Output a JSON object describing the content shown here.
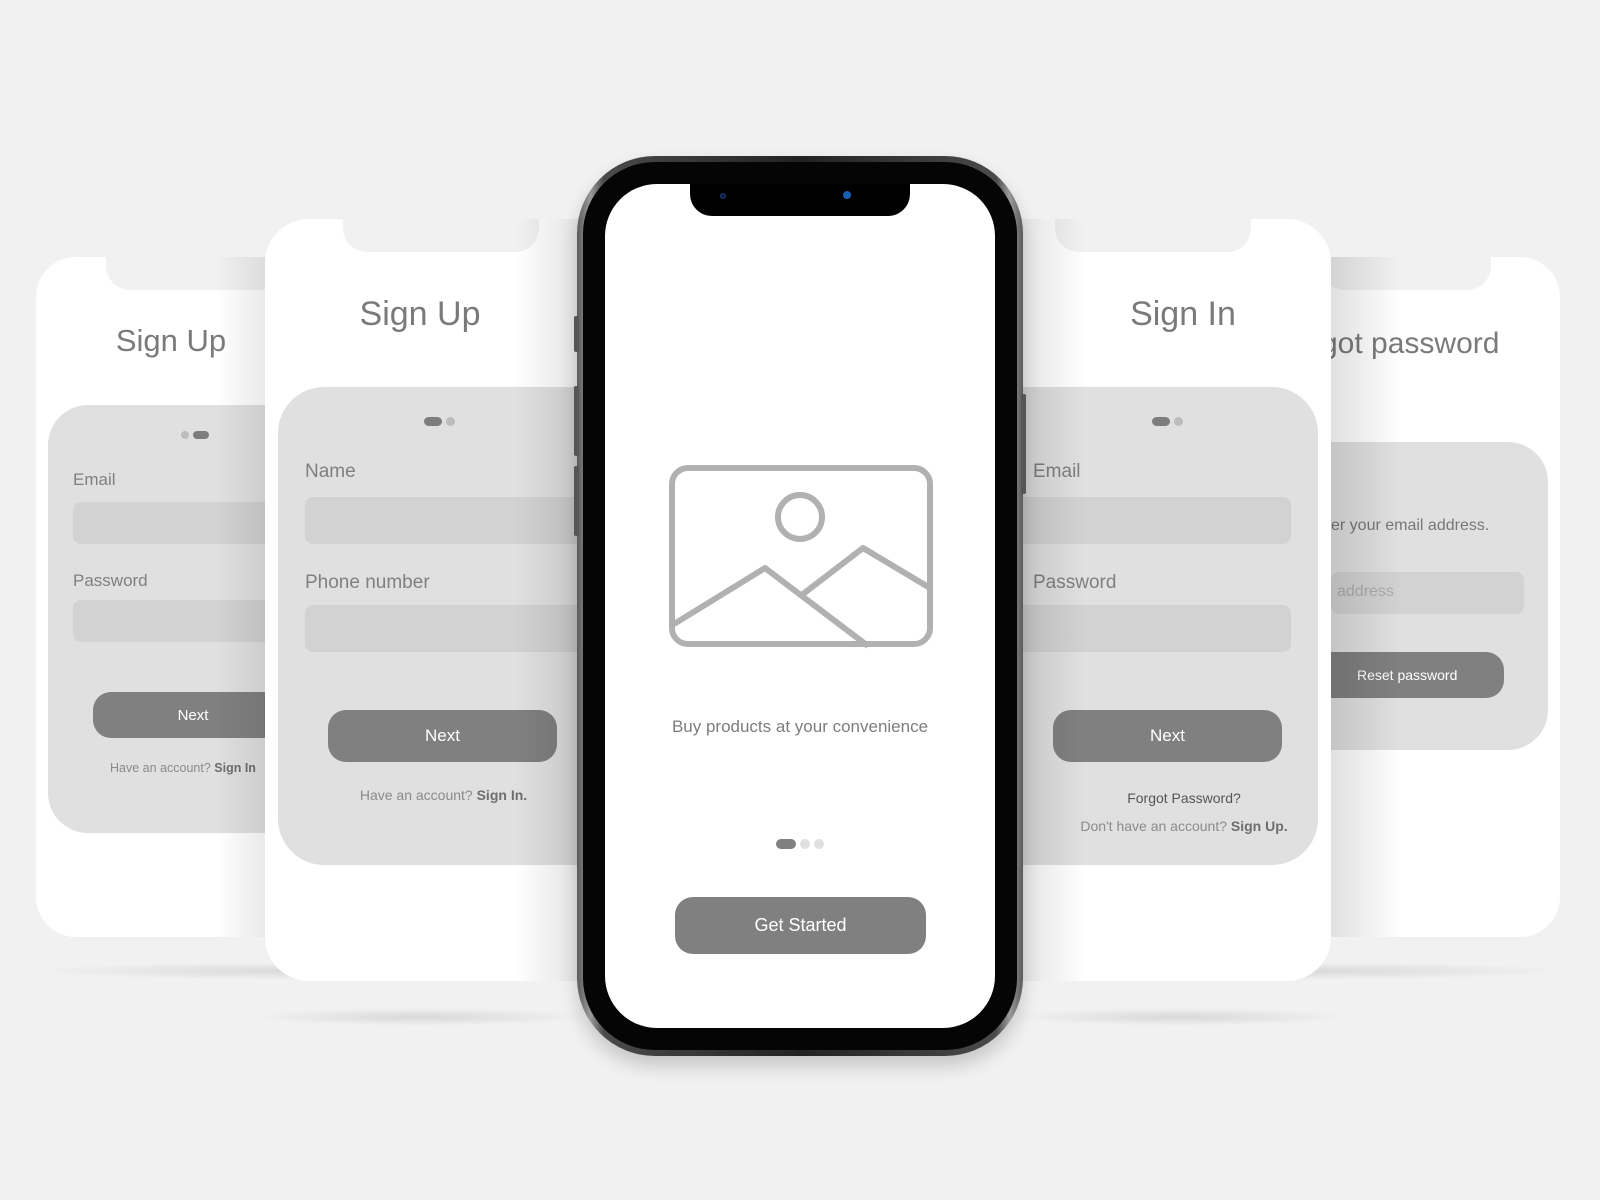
{
  "screens": {
    "far_left": {
      "title": "Sign Up",
      "step_dots": {
        "count": 2,
        "active_index": 1
      },
      "fields": [
        {
          "label": "Email",
          "value": ""
        },
        {
          "label": "Password",
          "value": ""
        }
      ],
      "button_label": "Next",
      "footer_text": "Have an account? ",
      "footer_link": "Sign In"
    },
    "left": {
      "title": "Sign Up",
      "step_dots": {
        "count": 2,
        "active_index": 0
      },
      "fields": [
        {
          "label": "Name",
          "value": ""
        },
        {
          "label": "Phone number",
          "value": ""
        }
      ],
      "button_label": "Next",
      "footer_text": "Have an account? ",
      "footer_link": "Sign In."
    },
    "center": {
      "image_icon": "image-placeholder-icon",
      "caption": "Buy products at your convenience",
      "page_dots": {
        "count": 3,
        "active_index": 0
      },
      "button_label": "Get Started"
    },
    "right": {
      "title": "Sign In",
      "step_dots": {
        "count": 2,
        "active_index": 0
      },
      "fields": [
        {
          "label": "Email",
          "value": ""
        },
        {
          "label": "Password",
          "value": ""
        }
      ],
      "button_label": "Next",
      "forgot_link": "Forgot Password?",
      "footer_text": "Don't have an account? ",
      "footer_link": "Sign Up."
    },
    "far_right": {
      "title": "got password",
      "instruction": "er your email address.",
      "email_placeholder": "address",
      "button_label": "Reset password"
    }
  },
  "colors": {
    "background": "#f1f1f1",
    "card": "#ffffff",
    "panel": "#e0e0e0",
    "field": "#d2d2d2",
    "button": "#808080",
    "text": "#7a7a7a"
  }
}
